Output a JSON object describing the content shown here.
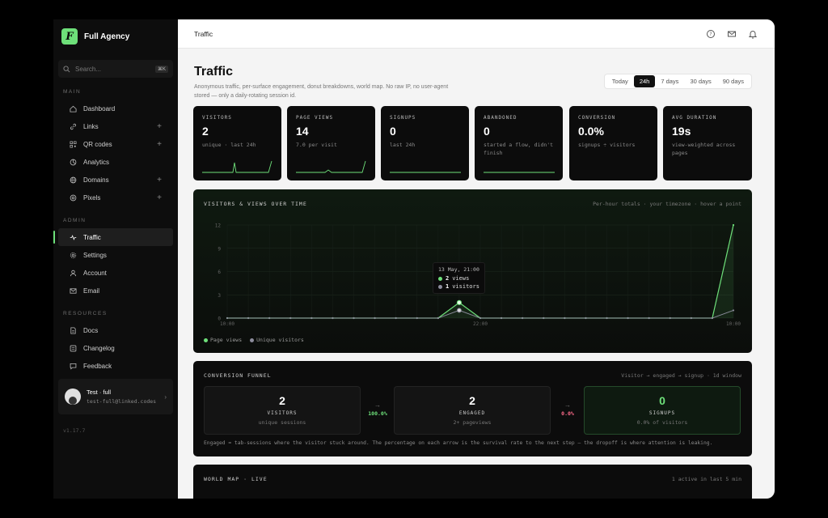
{
  "brand": {
    "logo_letter": "F",
    "name": "Full Agency"
  },
  "search": {
    "placeholder": "Search...",
    "shortcut": "⌘K"
  },
  "sidebar": {
    "main_label": "MAIN",
    "main_items": [
      {
        "label": "Dashboard",
        "icon": "home-icon"
      },
      {
        "label": "Links",
        "icon": "link-icon",
        "plus": "+"
      },
      {
        "label": "QR codes",
        "icon": "qr-icon",
        "plus": "+"
      },
      {
        "label": "Analytics",
        "icon": "analytics-icon"
      },
      {
        "label": "Domains",
        "icon": "globe-icon",
        "plus": "+"
      },
      {
        "label": "Pixels",
        "icon": "target-icon",
        "plus": "+"
      }
    ],
    "admin_label": "ADMIN",
    "admin_items": [
      {
        "label": "Traffic",
        "icon": "activity-icon",
        "active": true
      },
      {
        "label": "Settings",
        "icon": "gear-icon"
      },
      {
        "label": "Account",
        "icon": "user-icon"
      },
      {
        "label": "Email",
        "icon": "mail-icon"
      }
    ],
    "resources_label": "RESOURCES",
    "resources_items": [
      {
        "label": "Docs",
        "icon": "doc-icon"
      },
      {
        "label": "Changelog",
        "icon": "changelog-icon"
      },
      {
        "label": "Feedback",
        "icon": "chat-icon"
      }
    ],
    "user": {
      "name": "Test · full",
      "email": "test-full@linked.codes"
    },
    "version": "v1.17.7"
  },
  "topbar": {
    "breadcrumb": "Traffic"
  },
  "page": {
    "title": "Traffic",
    "subtitle": "Anonymous traffic, per-surface engagement, donut breakdowns, world map. No raw IP, no user-agent stored — only a daily-rotating session id.",
    "ranges": [
      "Today",
      "24h",
      "7 days",
      "30 days",
      "90 days"
    ],
    "active_range": "24h"
  },
  "stats": [
    {
      "label": "VISITORS",
      "value": "2",
      "sub": "unique · last 24h"
    },
    {
      "label": "PAGE VIEWS",
      "value": "14",
      "sub": "7.0 per visit"
    },
    {
      "label": "SIGNUPS",
      "value": "0",
      "sub": "last 24h"
    },
    {
      "label": "ABANDONED",
      "value": "0",
      "sub": "started a flow, didn't finish"
    },
    {
      "label": "CONVERSION",
      "value": "0.0%",
      "sub": "signups ÷ visitors"
    },
    {
      "label": "AVG DURATION",
      "value": "19s",
      "sub": "view-weighted across pages"
    }
  ],
  "chart": {
    "title": "VISITORS & VIEWS OVER TIME",
    "note": "Per-hour totals · your timezone · hover a point",
    "tooltip": {
      "title": "13 May, 21:00",
      "views": "2",
      "views_label": "views",
      "visitors": "1",
      "visitors_label": "visitors"
    },
    "legend": [
      "Page views",
      "Unique visitors"
    ],
    "colors": {
      "views": "#6ee07a",
      "visitors": "#8c8c9c"
    }
  },
  "chart_data": {
    "type": "line",
    "x": [
      "10:00",
      "11:00",
      "12:00",
      "13:00",
      "14:00",
      "15:00",
      "16:00",
      "17:00",
      "18:00",
      "19:00",
      "20:00",
      "21:00",
      "22:00",
      "23:00",
      "00:00",
      "01:00",
      "02:00",
      "03:00",
      "04:00",
      "05:00",
      "06:00",
      "07:00",
      "08:00",
      "09:00",
      "10:00"
    ],
    "x_tick_labels": [
      "10:00",
      "22:00",
      "10:00"
    ],
    "series": [
      {
        "name": "Page views",
        "values": [
          0,
          0,
          0,
          0,
          0,
          0,
          0,
          0,
          0,
          0,
          0,
          2,
          0,
          0,
          0,
          0,
          0,
          0,
          0,
          0,
          0,
          0,
          0,
          0,
          12
        ]
      },
      {
        "name": "Unique visitors",
        "values": [
          0,
          0,
          0,
          0,
          0,
          0,
          0,
          0,
          0,
          0,
          0,
          1,
          0,
          0,
          0,
          0,
          0,
          0,
          0,
          0,
          0,
          0,
          0,
          0,
          1
        ]
      }
    ],
    "yticks": [
      0,
      3,
      6,
      9,
      12
    ],
    "ylim": [
      0,
      12
    ],
    "grid": true,
    "legend_position": "bottom-left"
  },
  "funnel": {
    "title": "CONVERSION FUNNEL",
    "note": "Visitor → engaged → signup · 1d window",
    "steps": [
      {
        "value": "2",
        "label": "VISITORS",
        "sub": "unique sessions"
      },
      {
        "value": "2",
        "label": "ENGAGED",
        "sub": "2+ pageviews"
      },
      {
        "value": "0",
        "label": "SIGNUPS",
        "sub": "0.0% of visitors"
      }
    ],
    "arrows": [
      {
        "symbol": "→",
        "pct": "100.0%",
        "color": "#6ee07a"
      },
      {
        "symbol": "→",
        "pct": "0.0%",
        "color": "#ff6b8a"
      }
    ],
    "footnote": "Engaged = tab-sessions where the visitor stuck around. The percentage on each arrow is the survival rate to the next step — the dropoff is where attention is leaking."
  },
  "map": {
    "title": "WORLD MAP · LIVE",
    "note": "1 active in last 5 min"
  }
}
